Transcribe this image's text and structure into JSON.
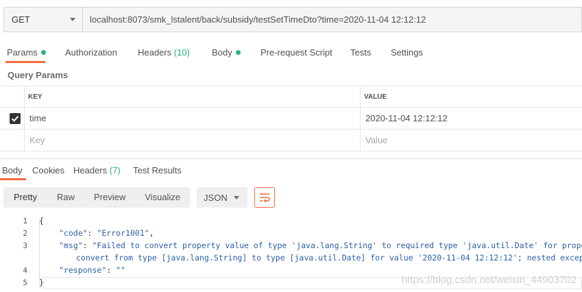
{
  "request": {
    "method": "GET",
    "url": "localhost:8073/smk_lstalent/back/subsidy/testSetTimeDto?time=2020-11-04 12:12:12"
  },
  "request_tabs": [
    {
      "label": "Params",
      "count": ""
    },
    {
      "label": "Authorization",
      "count": ""
    },
    {
      "label": "Headers",
      "count": "(10)"
    },
    {
      "label": "Body",
      "count": ""
    },
    {
      "label": "Pre-request Script",
      "count": ""
    },
    {
      "label": "Tests",
      "count": ""
    },
    {
      "label": "Settings",
      "count": ""
    }
  ],
  "query_params": {
    "title": "Query Params",
    "columns": {
      "key": "KEY",
      "value": "VALUE"
    },
    "rows": [
      {
        "key": "time",
        "value": "2020-11-04 12:12:12",
        "checked": true
      }
    ],
    "placeholders": {
      "key": "Key",
      "value": "Value"
    }
  },
  "response_tabs": [
    {
      "label": "Body",
      "count": ""
    },
    {
      "label": "Cookies",
      "count": ""
    },
    {
      "label": "Headers",
      "count": "(7)"
    },
    {
      "label": "Test Results",
      "count": ""
    }
  ],
  "view_modes": [
    "Pretty",
    "Raw",
    "Preview",
    "Visualize"
  ],
  "format": "JSON",
  "response_body": {
    "line_numbers": [
      "1",
      "2",
      "3",
      "",
      "4",
      "5"
    ],
    "open_brace": "{",
    "close_brace": "}",
    "code_key": "\"code\"",
    "code_value": "\"Error1001\"",
    "msg_key": "\"msg\"",
    "msg_value_line1": "\"Failed to convert property value of type 'java.lang.String' to required type 'java.util.Date' for property '",
    "msg_value_line2": "convert from type [java.lang.String] to type [java.util.Date] for value '2020-11-04 12:12:12'; nested exception",
    "response_key": "\"response\"",
    "response_value": "\"\""
  },
  "watermark": "https://blog.csdn.net/weixin_44903702",
  "colors": {
    "accent": "#f26b3a",
    "count": "#26b47f",
    "json": "#2a5ea8"
  }
}
